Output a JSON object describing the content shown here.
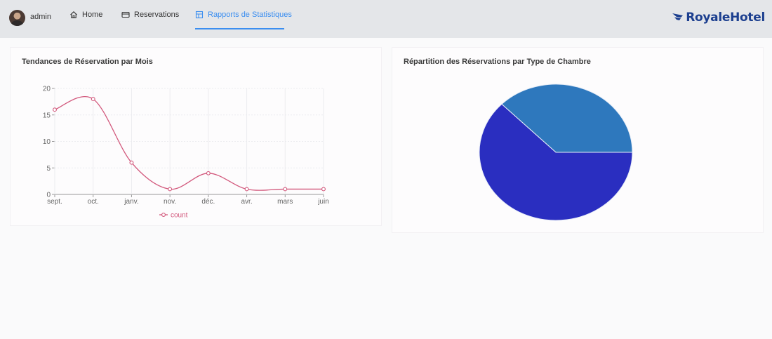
{
  "navbar": {
    "username": "admin",
    "items": [
      {
        "label": "Home",
        "icon": "home-icon"
      },
      {
        "label": "Reservations",
        "icon": "card-icon"
      },
      {
        "label": "Rapports de Statistiques",
        "icon": "table-icon",
        "active": true
      }
    ],
    "brand_part1": "Royale",
    "brand_part2": "Hotel",
    "accent_color": "#3b8ef0",
    "brand_color": "#1c3f8f"
  },
  "line_card": {
    "title": "Tendances de Réservation par Mois"
  },
  "pie_card": {
    "title": "Répartition des Réservations par Type de Chambre"
  },
  "chart_data": [
    {
      "type": "line",
      "title": "Tendances de Réservation par Mois",
      "categories": [
        "sept.",
        "oct.",
        "janv.",
        "nov.",
        "déc.",
        "avr.",
        "mars",
        "juin"
      ],
      "series": [
        {
          "name": "count",
          "values": [
            16,
            18,
            6,
            1,
            4,
            1,
            1,
            1
          ],
          "color": "#d2587c"
        }
      ],
      "y_ticks": [
        0,
        5,
        10,
        15,
        20
      ],
      "ylim": [
        0,
        20
      ],
      "grid": true,
      "legend": "bottom"
    },
    {
      "type": "pie",
      "title": "Répartition des Réservations par Type de Chambre",
      "slices": [
        {
          "value": 37.5,
          "color": "#2e78bd"
        },
        {
          "value": 62.5,
          "color": "#2a2ec0"
        }
      ],
      "legend": "none"
    }
  ]
}
